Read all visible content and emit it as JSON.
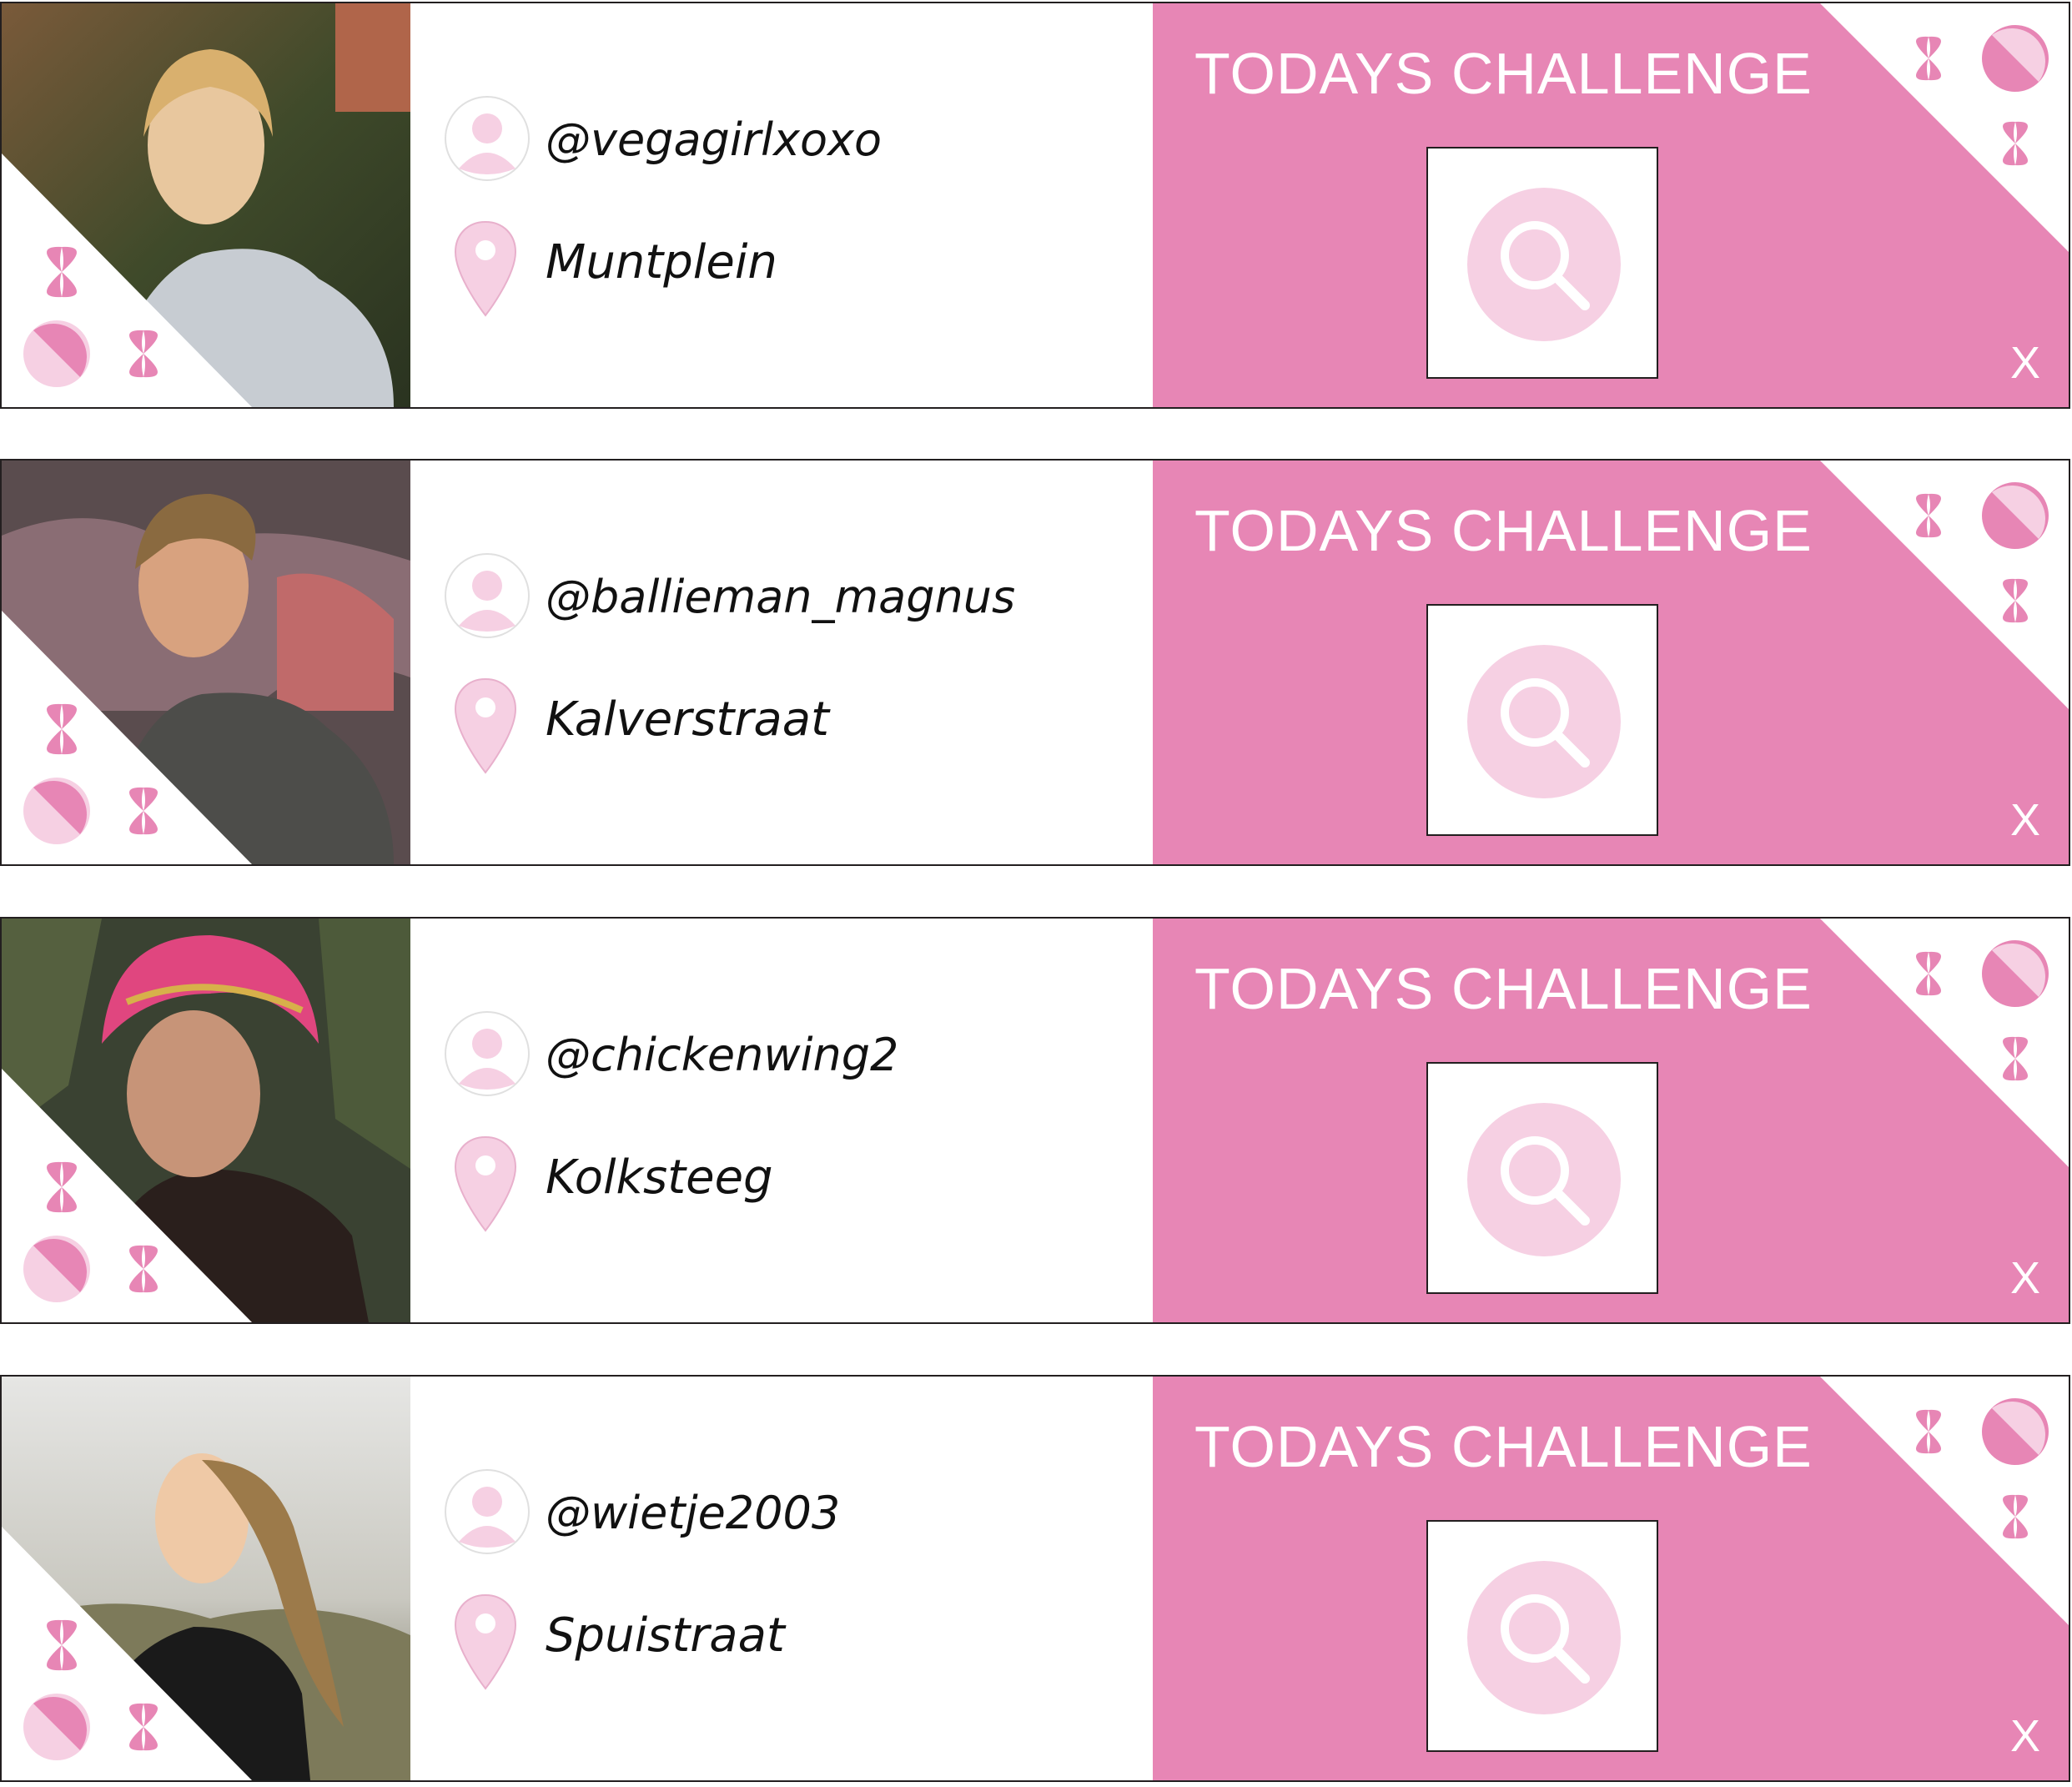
{
  "colors": {
    "accent_pink": "#e786b5",
    "light_pink": "#f6d0e3",
    "border": "#231f20"
  },
  "cards": [
    {
      "username": "@vegagirlxoxo",
      "location": "Muntplein",
      "challenge_title": "TODAYS CHALLENGE",
      "close_label": "X"
    },
    {
      "username": "@ballieman_magnus",
      "location": "Kalverstraat",
      "challenge_title": "TODAYS CHALLENGE",
      "close_label": "X"
    },
    {
      "username": "@chickenwing2",
      "location": "Kolksteeg",
      "challenge_title": "TODAYS CHALLENGE",
      "close_label": "X"
    },
    {
      "username": "@wietje2003",
      "location": "Spuistraat",
      "challenge_title": "TODAYS CHALLENGE",
      "close_label": "X"
    }
  ],
  "icons": {
    "avatar": "user-avatar-icon",
    "location": "map-pin-icon",
    "search": "magnifier-icon",
    "decor": [
      "butterfly-icon",
      "half-circle-icon"
    ]
  }
}
